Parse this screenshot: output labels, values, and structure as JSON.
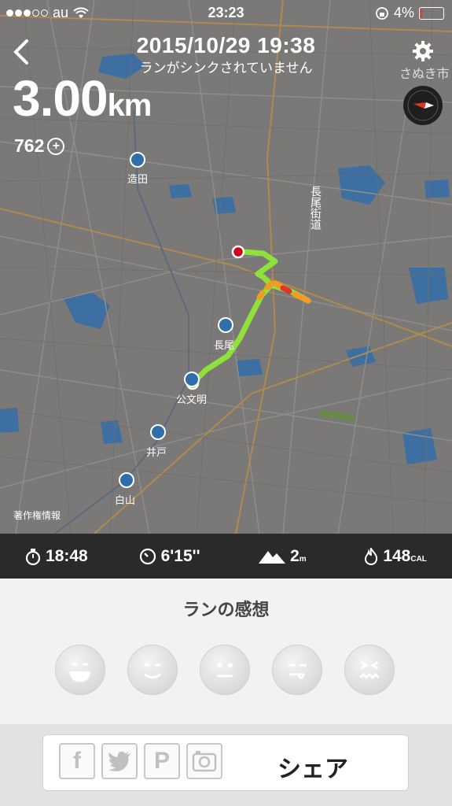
{
  "status_bar": {
    "carrier": "au",
    "time": "23:23",
    "battery": "4%"
  },
  "header": {
    "title": "2015/10/29  19:38",
    "subtitle": "ランがシンクされていません"
  },
  "summary": {
    "distance_value": "3.00",
    "distance_unit": "km",
    "nikefuel": "762"
  },
  "map": {
    "labels": {
      "station_1": "造田",
      "station_2": "長尾",
      "station_3": "公文明",
      "station_4": "井戸",
      "station_5": "白山",
      "street": "長尾街道",
      "city": "さぬき市",
      "copyright": "著作権情報"
    }
  },
  "stats": {
    "duration": "18:48",
    "pace": "6'15''",
    "elevation": "2",
    "elevation_unit": "m",
    "calories": "148",
    "calories_unit": "CAL"
  },
  "feeling": {
    "title": "ランの感想",
    "faces": [
      "great",
      "good",
      "ok",
      "meh",
      "bad"
    ]
  },
  "share": {
    "label": "シェア",
    "networks": [
      "facebook",
      "twitter",
      "pinterest",
      "instagram"
    ]
  },
  "colors": {
    "route_green": "#8ee23a",
    "route_orange": "#f39c25",
    "route_red": "#e03526",
    "start_marker": "#7ed321",
    "end_marker": "#d0021b",
    "stats_bar": "#2a2a2a"
  }
}
